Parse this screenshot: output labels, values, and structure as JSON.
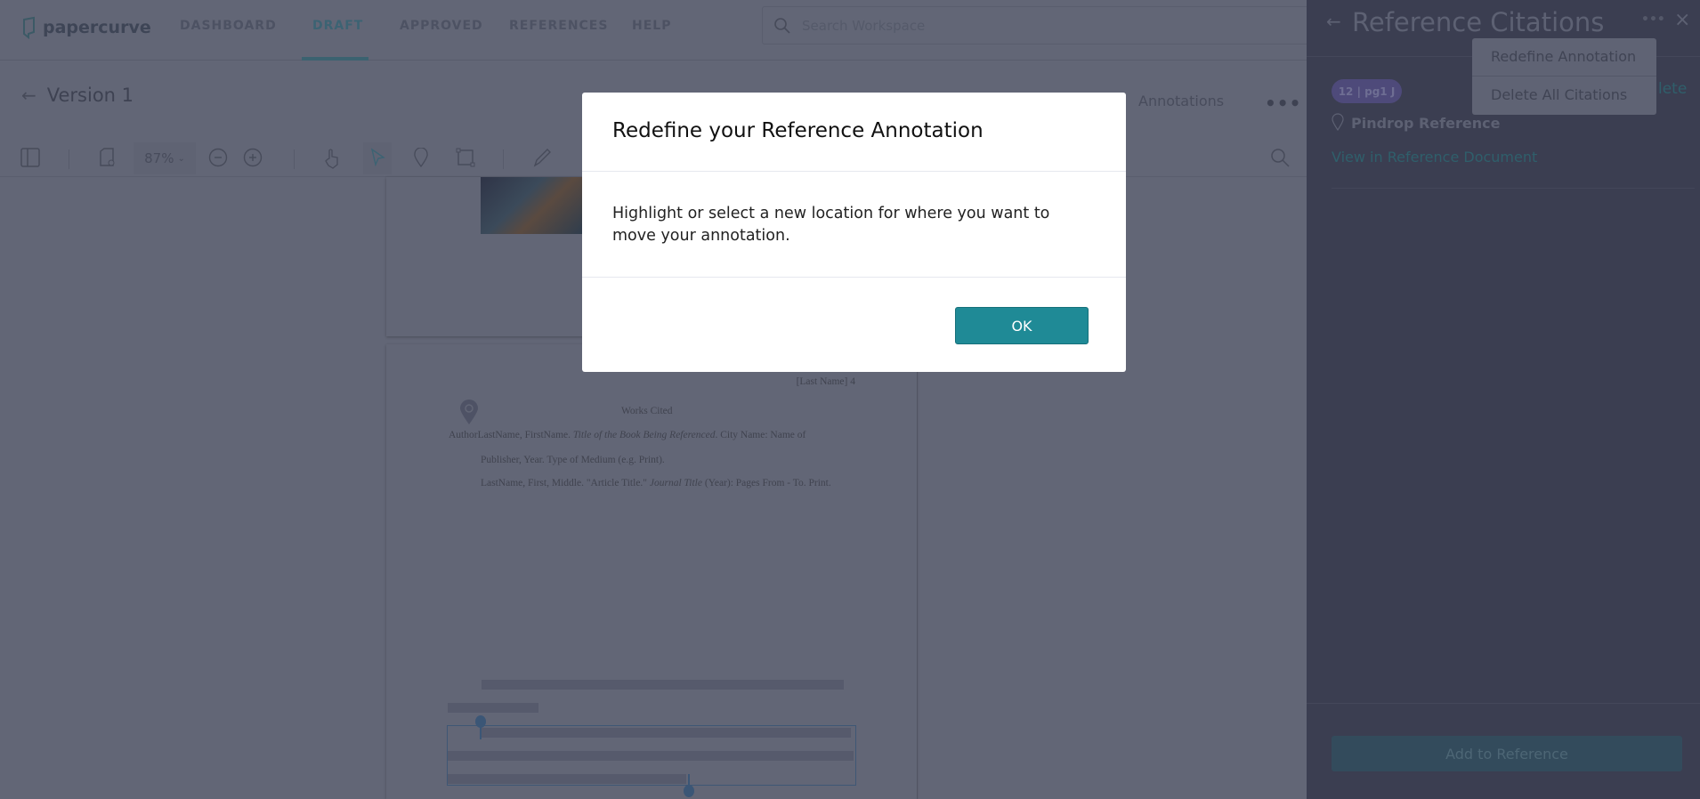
{
  "nav": {
    "logo": "papercurve",
    "items": [
      "DASHBOARD",
      "DRAFT",
      "APPROVED",
      "REFERENCES",
      "HELP"
    ],
    "active": "DRAFT",
    "search_placeholder": "Search Workspace"
  },
  "doc": {
    "title": "Version 1",
    "annotations_label": "Annotations",
    "zoom": "87%",
    "more": "•••"
  },
  "page": {
    "header": "[Last Name] 4",
    "heading": "Works Cited",
    "line1_a": "AuthorLastName, FirstName. ",
    "line1_b": "Title of the Book Being Referenced",
    "line1_c": ". City Name: Name of",
    "line2": "Publisher, Year. Type of Medium (e.g. Print).",
    "line3_a": "LastName, First, Middle. \"Article Title.\" ",
    "line3_b": "Journal Title",
    "line3_c": " (Year): Pages From - To. Print."
  },
  "modal": {
    "title": "Redefine your Reference Annotation",
    "body": "Highlight or select a new location for where you want to move your annotation.",
    "ok": "OK"
  },
  "panel": {
    "title": "Reference Citations",
    "menu": [
      "Redefine Annotation",
      "Delete All Citations"
    ],
    "badge": "12 | pg1 J",
    "delete_partial": "lete",
    "reference_name": "Pindrop Reference",
    "view_link": "View in Reference Document",
    "add_button": "Add to Reference",
    "more": "•••",
    "close": "×"
  },
  "colors": {
    "accent": "#1f8a96",
    "panel": "#3b3e51"
  }
}
